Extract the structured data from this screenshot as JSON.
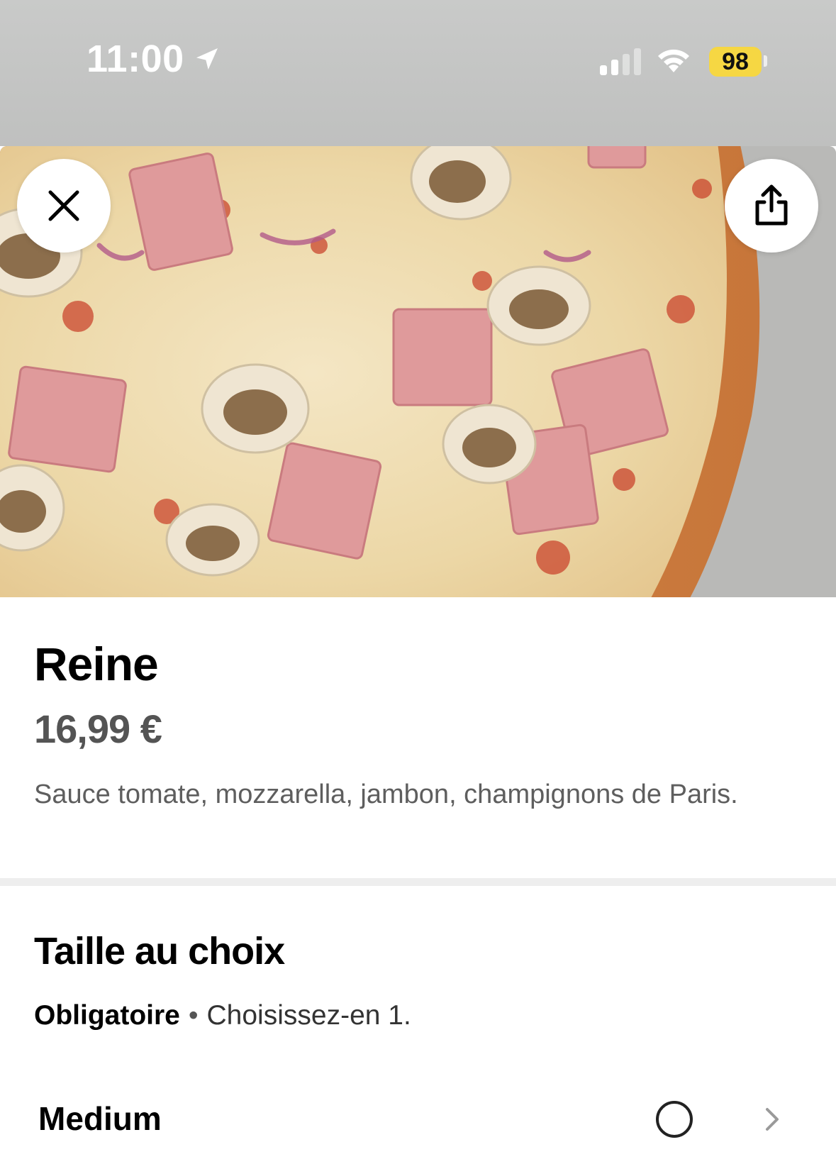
{
  "status_bar": {
    "time": "11:00",
    "battery": "98",
    "icons": [
      "location-arrow-icon",
      "signal-icon",
      "wifi-icon",
      "battery-icon"
    ],
    "battery_color": "#f6d743"
  },
  "hero": {
    "image_subject": "pizza-image",
    "close_icon": "close-icon",
    "share_icon": "share-icon"
  },
  "product": {
    "name": "Reine",
    "price": "16,99 €",
    "description": "Sauce tomate, mozzarella, jambon, champignons de Paris."
  },
  "options_section": {
    "title": "Taille au choix",
    "required_label": "Obligatoire",
    "separator": "•",
    "instruction": "Choisissez-en 1.",
    "options": [
      {
        "label": "Medium",
        "selected": false
      }
    ]
  }
}
